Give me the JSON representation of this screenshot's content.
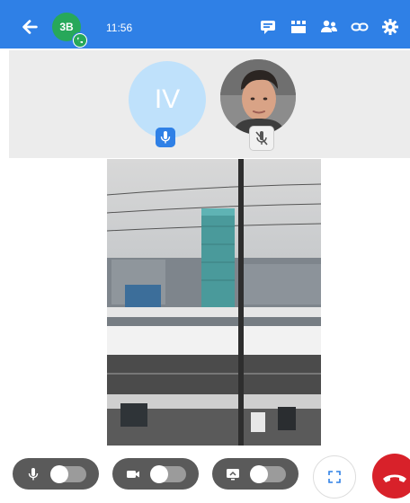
{
  "header": {
    "contact_initials": "3B",
    "time": "11:56",
    "icons": [
      "arrow-left-icon",
      "chat-icon",
      "grid-icon",
      "participants-icon",
      "link-icon",
      "gear-icon"
    ]
  },
  "participants": [
    {
      "initials": "IV",
      "mic": "on"
    },
    {
      "initials": "",
      "mic": "muted"
    }
  ],
  "controls": {
    "mic_toggle": "off",
    "camera_toggle": "off",
    "screen_share_toggle": "off",
    "colors": {
      "top_bar": "#2f80e6",
      "hangup": "#d8212a",
      "pill": "#5a5a5a"
    }
  }
}
